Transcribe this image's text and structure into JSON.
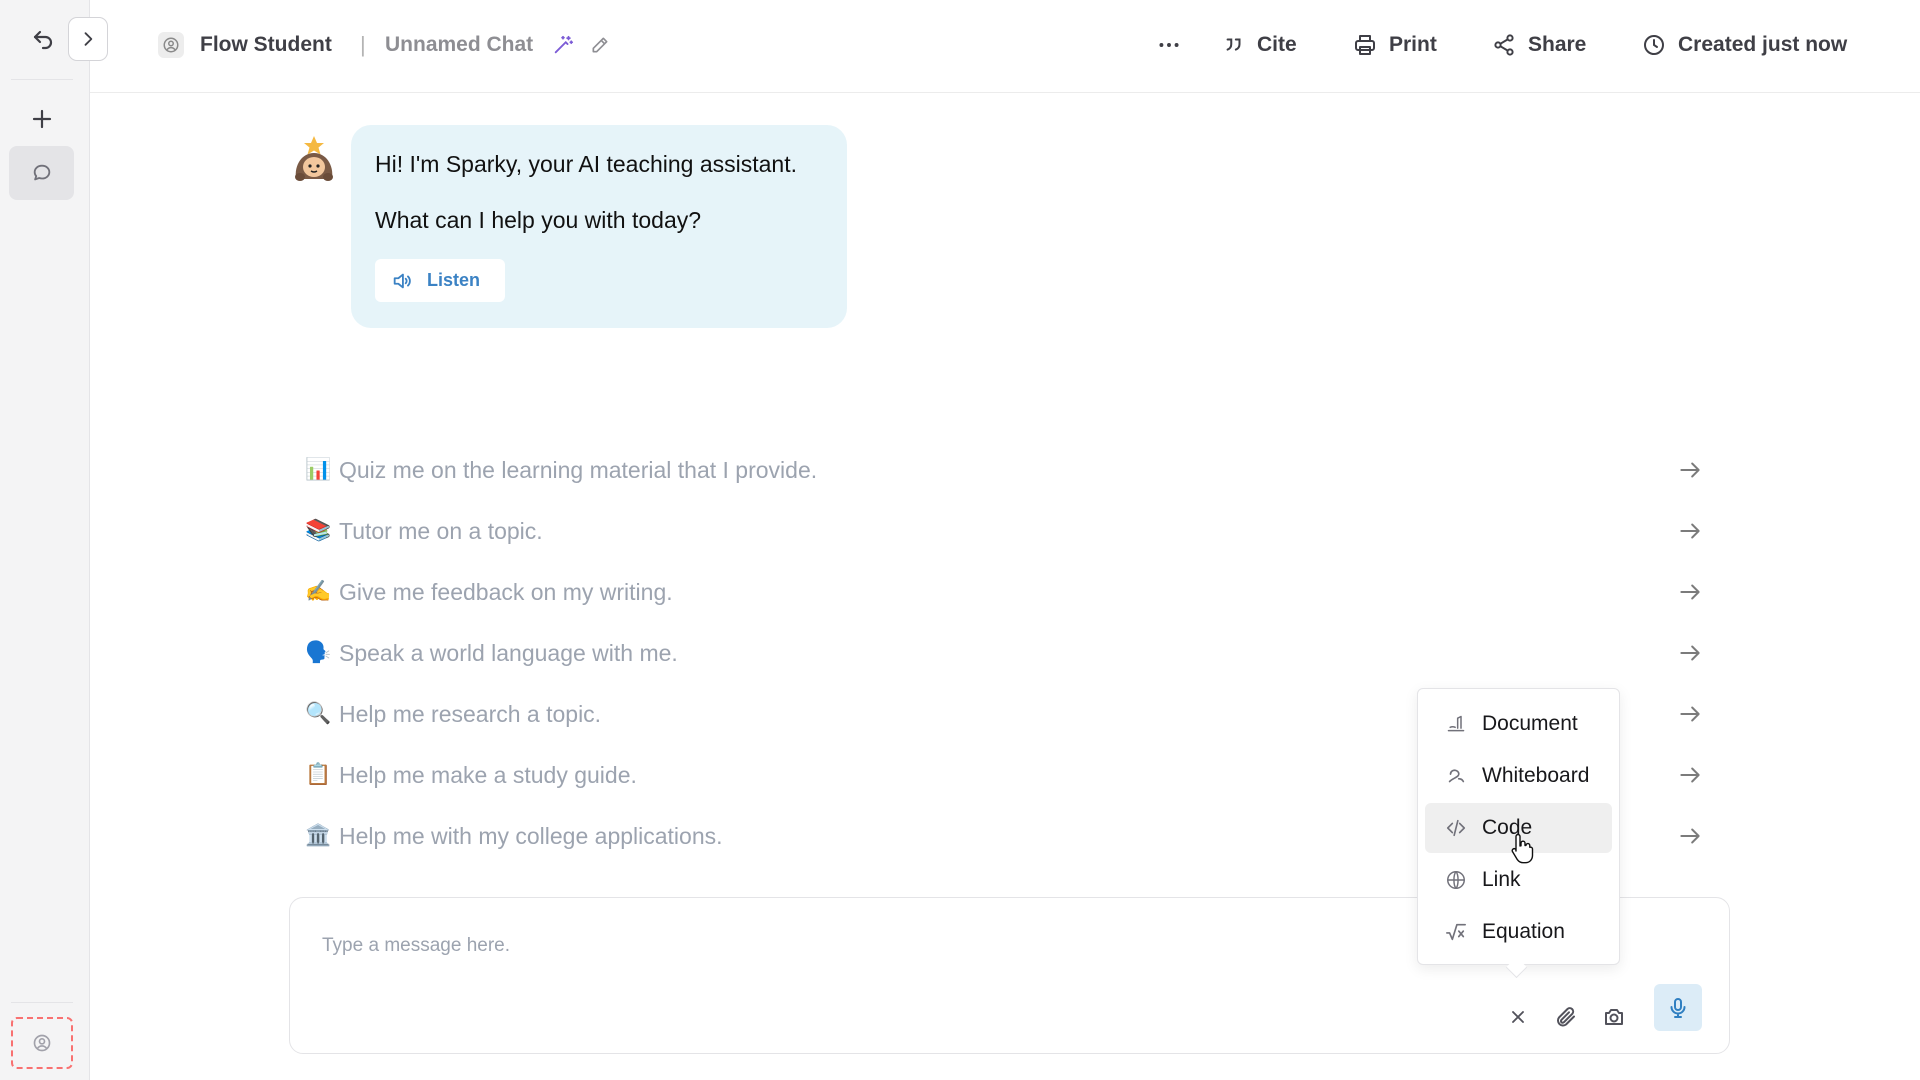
{
  "app": {
    "name": "Flow Student",
    "chat_title": "Unnamed Chat"
  },
  "header": {
    "more_label": "More options",
    "cite_label": "Cite",
    "print_label": "Print",
    "share_label": "Share",
    "created_label": "Created just now"
  },
  "greeting": {
    "line1": "Hi! I'm Sparky, your AI teaching assistant.",
    "line2": "What can I help you with today?",
    "listen_label": "Listen"
  },
  "suggestions": [
    {
      "emoji": "📊",
      "text": "Quiz me on the learning material that I provide."
    },
    {
      "emoji": "📚",
      "text": "Tutor me on a topic."
    },
    {
      "emoji": "✍️",
      "text": "Give me feedback on my writing."
    },
    {
      "emoji": "🗣️",
      "text": "Speak a world language with me."
    },
    {
      "emoji": "🔍",
      "text": "Help me research a topic."
    },
    {
      "emoji": "📋",
      "text": "Help me make a study guide."
    },
    {
      "emoji": "🏛️",
      "text": "Help me with my college applications."
    }
  ],
  "composer": {
    "placeholder": "Type a message here.",
    "value": ""
  },
  "attach_menu": {
    "items": [
      {
        "label": "Document",
        "icon": "document-icon"
      },
      {
        "label": "Whiteboard",
        "icon": "whiteboard-icon"
      },
      {
        "label": "Code",
        "icon": "code-icon",
        "hovered": true
      },
      {
        "label": "Link",
        "icon": "globe-icon"
      },
      {
        "label": "Equation",
        "icon": "square-root-icon"
      }
    ]
  },
  "colors": {
    "bubble_bg": "#e6f4f9",
    "accent_blue": "#3b82c4",
    "mic_bg": "#dcecf7",
    "rail_bg": "#f4f4f5",
    "profile_dashed_border": "#f87171",
    "magic_wand": "#7c5cd6"
  }
}
